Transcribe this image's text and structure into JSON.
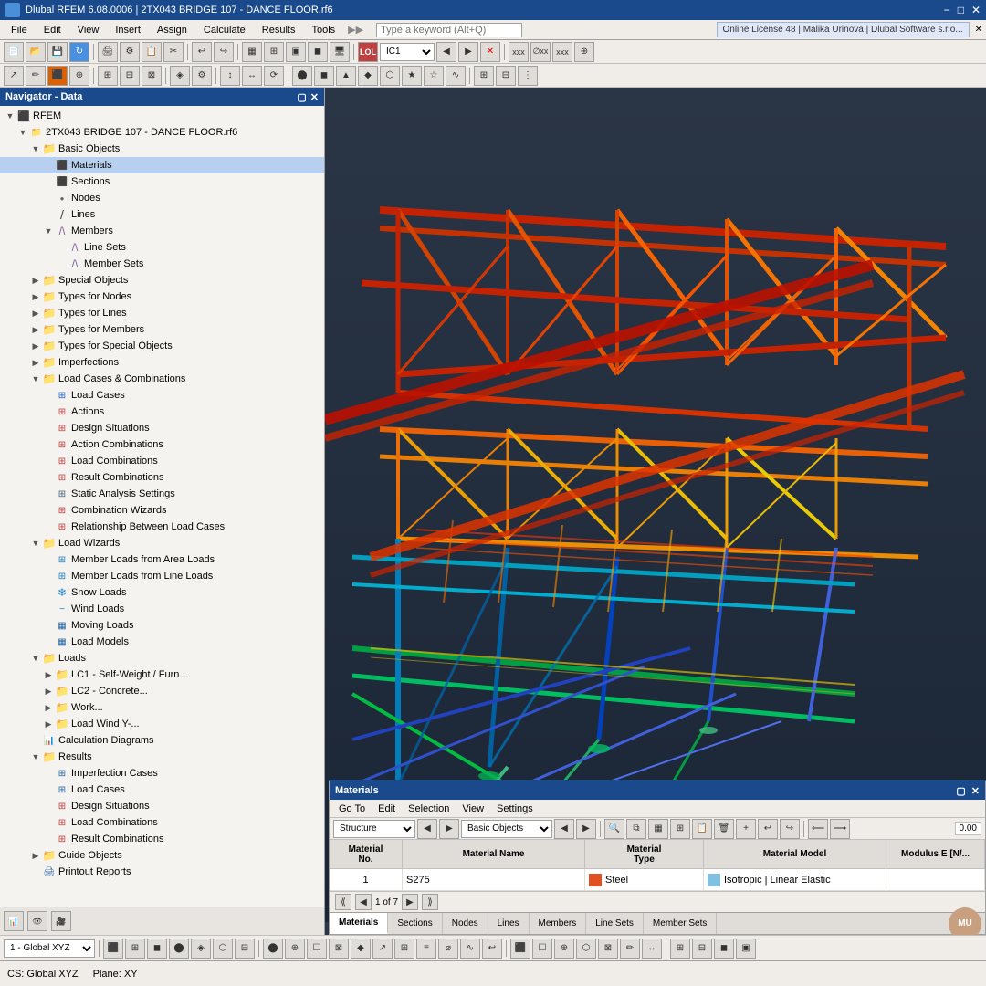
{
  "titleBar": {
    "title": "Dlubal RFEM 6.08.0006 | 2TX043 BRIDGE 107 - DANCE FLOOR.rf6",
    "icon": "■",
    "buttons": [
      "−",
      "□",
      "✕"
    ]
  },
  "menuBar": {
    "items": [
      "File",
      "Edit",
      "View",
      "Insert",
      "Assign",
      "Calculate",
      "Results",
      "Tools"
    ],
    "searchPlaceholder": "Type a keyword (Alt+Q)",
    "licenseInfo": "Online License 48 | Malika Urinova | Dlubal Software s.r.o..."
  },
  "navigator": {
    "title": "Navigator - Data",
    "tree": [
      {
        "level": 0,
        "label": "RFEM",
        "type": "root",
        "arrow": "▼"
      },
      {
        "level": 1,
        "label": "2TX043 BRIDGE 107 - DANCE FLOOR.rf6",
        "type": "file",
        "arrow": "▼"
      },
      {
        "level": 2,
        "label": "Basic Objects",
        "type": "folder",
        "arrow": "▼"
      },
      {
        "level": 3,
        "label": "Materials",
        "type": "item-mat",
        "arrow": ""
      },
      {
        "level": 3,
        "label": "Sections",
        "type": "item-sec",
        "arrow": ""
      },
      {
        "level": 3,
        "label": "Nodes",
        "type": "item-node",
        "arrow": ""
      },
      {
        "level": 3,
        "label": "Lines",
        "type": "item-line",
        "arrow": ""
      },
      {
        "level": 3,
        "label": "Members",
        "type": "item-member",
        "arrow": "▼"
      },
      {
        "level": 4,
        "label": "Line Sets",
        "type": "item-lineset",
        "arrow": ""
      },
      {
        "level": 4,
        "label": "Member Sets",
        "type": "item-memberset",
        "arrow": ""
      },
      {
        "level": 2,
        "label": "Special Objects",
        "type": "folder",
        "arrow": "▶"
      },
      {
        "level": 2,
        "label": "Types for Nodes",
        "type": "folder",
        "arrow": "▶"
      },
      {
        "level": 2,
        "label": "Types for Lines",
        "type": "folder",
        "arrow": "▶"
      },
      {
        "level": 2,
        "label": "Types for Members",
        "type": "folder",
        "arrow": "▶"
      },
      {
        "level": 2,
        "label": "Types for Special Objects",
        "type": "folder",
        "arrow": "▶"
      },
      {
        "level": 2,
        "label": "Imperfections",
        "type": "folder",
        "arrow": "▶"
      },
      {
        "level": 2,
        "label": "Load Cases & Combinations",
        "type": "folder",
        "arrow": "▼"
      },
      {
        "level": 3,
        "label": "Load Cases",
        "type": "item-lc",
        "arrow": ""
      },
      {
        "level": 3,
        "label": "Actions",
        "type": "item-action",
        "arrow": ""
      },
      {
        "level": 3,
        "label": "Design Situations",
        "type": "item-ds",
        "arrow": ""
      },
      {
        "level": 3,
        "label": "Action Combinations",
        "type": "item-ac",
        "arrow": ""
      },
      {
        "level": 3,
        "label": "Load Combinations",
        "type": "item-lco",
        "arrow": ""
      },
      {
        "level": 3,
        "label": "Result Combinations",
        "type": "item-rc",
        "arrow": ""
      },
      {
        "level": 3,
        "label": "Static Analysis Settings",
        "type": "item-sas",
        "arrow": ""
      },
      {
        "level": 3,
        "label": "Combination Wizards",
        "type": "item-cw",
        "arrow": ""
      },
      {
        "level": 3,
        "label": "Relationship Between Load Cases",
        "type": "item-rel",
        "arrow": ""
      },
      {
        "level": 2,
        "label": "Load Wizards",
        "type": "folder",
        "arrow": "▼"
      },
      {
        "level": 3,
        "label": "Member Loads from Area Loads",
        "type": "item-wiz",
        "arrow": ""
      },
      {
        "level": 3,
        "label": "Member Loads from Line Loads",
        "type": "item-wiz",
        "arrow": ""
      },
      {
        "level": 3,
        "label": "Snow Loads",
        "type": "item-wiz",
        "arrow": ""
      },
      {
        "level": 3,
        "label": "Wind Loads",
        "type": "item-wiz",
        "arrow": ""
      },
      {
        "level": 3,
        "label": "Moving Loads",
        "type": "item-wiz",
        "arrow": ""
      },
      {
        "level": 3,
        "label": "Load Models",
        "type": "item-wiz",
        "arrow": ""
      },
      {
        "level": 2,
        "label": "Loads",
        "type": "folder",
        "arrow": "▼"
      },
      {
        "level": 3,
        "label": "LC1 - Self-Weight / Furn...",
        "type": "folder-lc",
        "arrow": "▶"
      },
      {
        "level": 3,
        "label": "LC2 - Concrete...",
        "type": "folder-lc",
        "arrow": "▶"
      },
      {
        "level": 3,
        "label": "Work...",
        "type": "folder-lc",
        "arrow": "▶"
      },
      {
        "level": 3,
        "label": "Load Wind Y-...",
        "type": "folder-lc",
        "arrow": "▶"
      },
      {
        "level": 2,
        "label": "Calculation Diagrams",
        "type": "item-cd",
        "arrow": ""
      },
      {
        "level": 2,
        "label": "Results",
        "type": "folder",
        "arrow": "▼"
      },
      {
        "level": 3,
        "label": "Imperfection Cases",
        "type": "item-imp",
        "arrow": ""
      },
      {
        "level": 3,
        "label": "Load Cases",
        "type": "item-lc2",
        "arrow": ""
      },
      {
        "level": 3,
        "label": "Design Situations",
        "type": "item-ds2",
        "arrow": ""
      },
      {
        "level": 3,
        "label": "Load Combinations",
        "type": "item-lco2",
        "arrow": ""
      },
      {
        "level": 3,
        "label": "Result Combinations",
        "type": "item-rc2",
        "arrow": ""
      },
      {
        "level": 2,
        "label": "Guide Objects",
        "type": "folder",
        "arrow": "▶"
      },
      {
        "level": 2,
        "label": "Printout Reports",
        "type": "item-pr",
        "arrow": ""
      }
    ]
  },
  "materials": {
    "title": "Materials",
    "menuItems": [
      "Go To",
      "Edit",
      "Selection",
      "View",
      "Settings"
    ],
    "toolbar": {
      "combo1": "Structure",
      "combo2": "Basic Objects"
    },
    "tableHeaders": [
      "Material No.",
      "Material Name",
      "Material Type",
      "Material Model",
      "Modulus E [N/..."
    ],
    "rows": [
      {
        "no": "1",
        "name": "S275",
        "type": "Steel",
        "typeColor": "#e05020",
        "model": "Isotropic | Linear Elastic",
        "modelColor": "#80c0e0",
        "modulus": ""
      }
    ],
    "pagination": "1 of 7",
    "tabs": [
      "Materials",
      "Sections",
      "Nodes",
      "Lines",
      "Members",
      "Line Sets",
      "Member Sets"
    ]
  },
  "statusBar": {
    "coord": "1 - Global XYZ",
    "csLabel": "CS: Global XYZ",
    "planeLabel": "Plane: XY"
  },
  "colors": {
    "accent": "#1a4a8c",
    "folderYellow": "#e8c040",
    "structureRed": "#cc2200",
    "structureOrange": "#ff8800",
    "structureYellow": "#ffdd00",
    "structureGreen": "#00cc44",
    "structureCyan": "#00aacc",
    "structureBlue": "#0044cc"
  }
}
